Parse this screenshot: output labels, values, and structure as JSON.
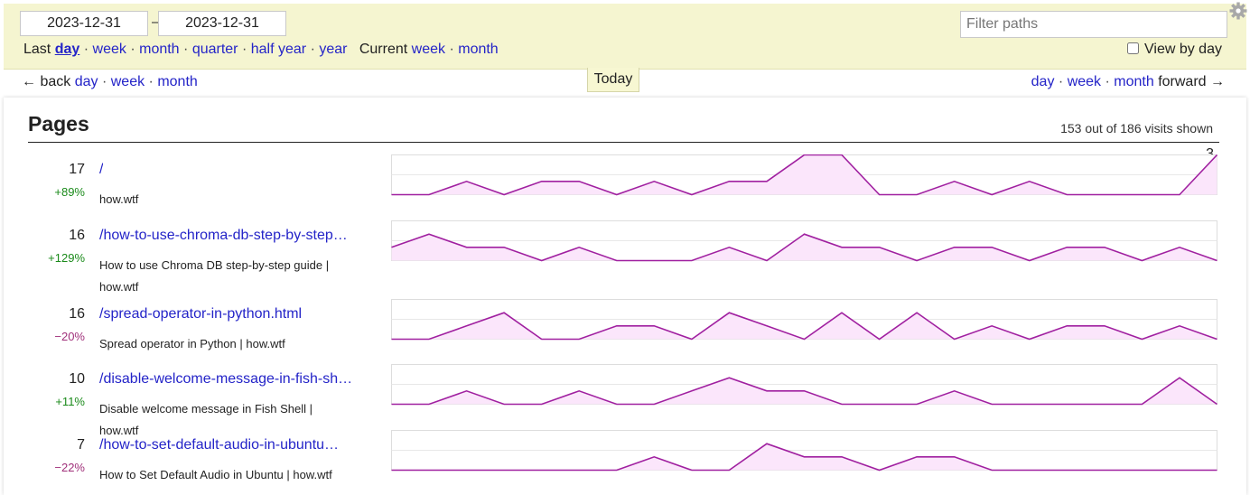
{
  "date_range": {
    "start": "2023-12-31",
    "end": "2023-12-31",
    "separator": "–"
  },
  "periods": {
    "last_label": "Last",
    "last_options": [
      "day",
      "week",
      "month",
      "quarter",
      "half year",
      "year"
    ],
    "selected": "day",
    "current_label": "Current",
    "current_options": [
      "week",
      "month"
    ]
  },
  "filter": {
    "placeholder": "Filter paths",
    "value": ""
  },
  "view_by_day": {
    "label": "View by day",
    "checked": false
  },
  "nav": {
    "back_label": "← back",
    "back_options": [
      "day",
      "week",
      "month"
    ],
    "forward_options": [
      "day",
      "week",
      "month"
    ],
    "forward_label": "forward →",
    "today": "Today"
  },
  "pages": {
    "heading": "Pages",
    "shown_text": "153 out of 186 visits shown",
    "max_label": "3",
    "colors": {
      "line": "#a020a0",
      "fill": "#fbe6fb",
      "grid": "#dddddd",
      "up": "#1a8a1a",
      "down": "#a0307a"
    },
    "rows": [
      {
        "count": "17",
        "change": "+89%",
        "direction": "up",
        "path": "/",
        "title": "how.wtf",
        "visits": [
          0,
          0,
          1,
          0,
          1,
          1,
          0,
          1,
          0,
          1,
          1,
          3,
          3,
          0,
          0,
          1,
          0,
          1,
          0,
          0,
          0,
          0,
          3
        ]
      },
      {
        "count": "16",
        "change": "+129%",
        "direction": "up",
        "path": "/how-to-use-chroma-db-step-by-step…",
        "title": "How to use Chroma DB step-by-step guide | how.wtf",
        "visits": [
          1,
          2,
          1,
          1,
          0,
          1,
          0,
          0,
          0,
          1,
          0,
          2,
          1,
          1,
          0,
          1,
          1,
          0,
          1,
          1,
          0,
          1,
          0
        ]
      },
      {
        "count": "16",
        "change": "−20%",
        "direction": "down",
        "path": "/spread-operator-in-python.html",
        "title": "Spread operator in Python | how.wtf",
        "visits": [
          0,
          0,
          1,
          2,
          0,
          0,
          1,
          1,
          0,
          2,
          1,
          0,
          2,
          0,
          2,
          0,
          1,
          0,
          1,
          1,
          0,
          1,
          0
        ]
      },
      {
        "count": "10",
        "change": "+11%",
        "direction": "up",
        "path": "/disable-welcome-message-in-fish-sh…",
        "title": "Disable welcome message in Fish Shell | how.wtf",
        "visits": [
          0,
          0,
          1,
          0,
          0,
          1,
          0,
          0,
          1,
          2,
          1,
          1,
          0,
          0,
          0,
          1,
          0,
          0,
          0,
          0,
          0,
          2,
          0
        ]
      },
      {
        "count": "7",
        "change": "−22%",
        "direction": "down",
        "path": "/how-to-set-default-audio-in-ubuntu…",
        "title": "How to Set Default Audio in Ubuntu | how.wtf",
        "visits": [
          0,
          0,
          0,
          0,
          0,
          0,
          0,
          1,
          0,
          0,
          2,
          1,
          1,
          0,
          1,
          1,
          0,
          0,
          0,
          0,
          0,
          0,
          0
        ]
      }
    ]
  }
}
